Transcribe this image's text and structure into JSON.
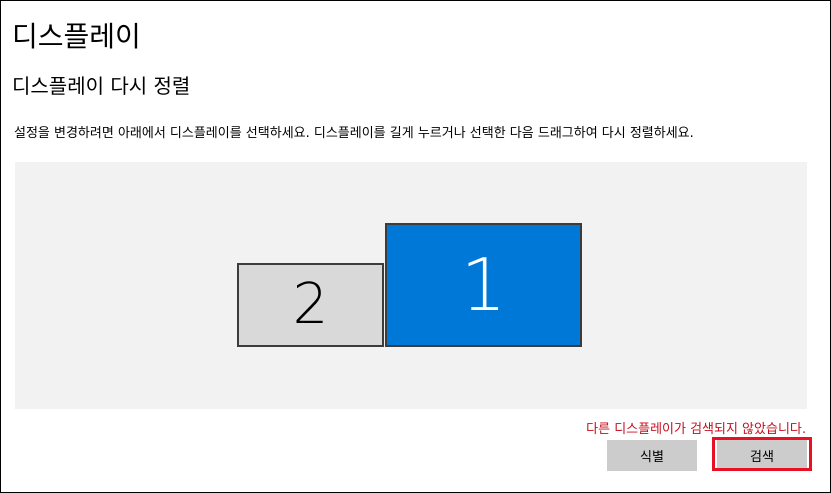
{
  "header": {
    "page_title": "디스플레이",
    "section_title": "디스플레이 다시 정렬"
  },
  "instructions": "설정을 변경하려면 아래에서 디스플레이를 선택하세요. 디스플레이를 길게 누르거나 선택한 다음 드래그하여 다시 정렬하세요.",
  "arrangement": {
    "monitors": [
      {
        "number": "1",
        "selected": true,
        "color": "#0078d7"
      },
      {
        "number": "2",
        "selected": false,
        "color": "#d9d9d9"
      }
    ]
  },
  "status_message": "다른 디스플레이가 검색되지 않았습니다.",
  "buttons": {
    "identify_label": "식별",
    "detect_label": "검색"
  },
  "colors": {
    "accent": "#0078d7",
    "error": "#c50f1f",
    "highlight": "#e81123"
  }
}
